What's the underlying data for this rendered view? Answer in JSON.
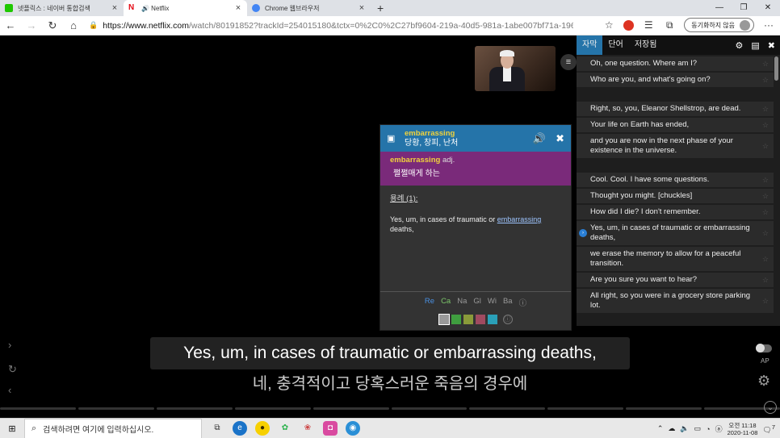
{
  "browser": {
    "tabs": [
      {
        "title": "넷플릭스 : 네이버 통합검색",
        "favicon_color": "#1ec800",
        "active": false
      },
      {
        "title": "🔊 Netflix",
        "favicon_color": "#e50914",
        "active": true
      },
      {
        "title": "Chrome 웹브라우저",
        "favicon_color": "#4285f4",
        "active": false
      }
    ],
    "url_host": "https://www.netflix.com",
    "url_rest": "/watch/80191852?trackId=254015180&tctx=0%2C0%2C27bf9604-219a-40d5-981a-1abe007bf71a-1966...",
    "sync_label": "동기화하지 않음"
  },
  "dictionary": {
    "word": "embarrassing",
    "word_meaning": "당황, 창피, 난처",
    "pos_word": "embarrassing",
    "pos": "adj.",
    "definition": "쩔쩔매게 하는",
    "example_label": "용례 (1):",
    "example_before": "Yes, um, in cases of traumatic or ",
    "example_keyword": "embarrassing",
    "example_after": " deaths,",
    "sources": [
      "Re",
      "Ca",
      "Na",
      "Gl",
      "Wi",
      "Ba"
    ],
    "info_glyph": "ⓘ",
    "swatch_colors": [
      "#999999",
      "#3f9e3f",
      "#8a9a3a",
      "#a04a60",
      "#2aa0b8"
    ]
  },
  "panel": {
    "tabs": [
      "자막",
      "단어",
      "저장됨"
    ],
    "lines": [
      "Oh, one question. Where am I?",
      "Who are you, and what's going on?",
      "",
      "Right, so, you, Eleanor Shellstrop, are dead.",
      "Your life on Earth has ended,",
      "and you are now in the next phase of your existence in the universe.",
      "",
      "Cool. Cool. I have some questions.",
      "Thought you might. [chuckles]",
      "How did I die? I don't remember.",
      "Yes, um, in cases of traumatic or embarrassing deaths,",
      "we erase the memory to allow for a peaceful transition.",
      "Are you sure you want to hear?",
      "All right, so you were in a grocery store parking lot."
    ],
    "current_index": 10
  },
  "captions": {
    "english": "Yes, um, in cases of traumatic or embarrassing deaths,",
    "korean": "네, 충격적이고 당혹스러운 죽음의 경우에"
  },
  "player": {
    "ap_label": "AP"
  },
  "taskbar": {
    "search_placeholder": "검색하려면 여기에 입력하십시오.",
    "time": "오전 11:18",
    "date": "2020-11-08",
    "notif_count": "7"
  }
}
